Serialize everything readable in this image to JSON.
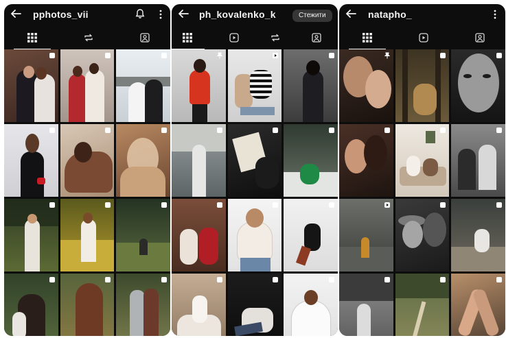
{
  "panels": [
    {
      "username": "pphotos_vii",
      "follow_label": ""
    },
    {
      "username": "ph_kovalenko_k",
      "follow_label": "Стежити"
    },
    {
      "username": "natapho_",
      "follow_label": ""
    }
  ],
  "icons": {
    "back": "arrow-left-icon",
    "grid": "grid-icon",
    "reels": "reels-icon",
    "reposts": "repost-icon",
    "tagged": "tagged-icon",
    "notifications": "bell-icon",
    "more": "more-vertical-icon",
    "multi_photo": "carousel-icon",
    "pinned": "pin-icon",
    "video": "video-icon"
  },
  "colors": {
    "panel_bg": "#0d0d0d",
    "text": "#f2f2f2",
    "follow_bg": "#363636"
  }
}
